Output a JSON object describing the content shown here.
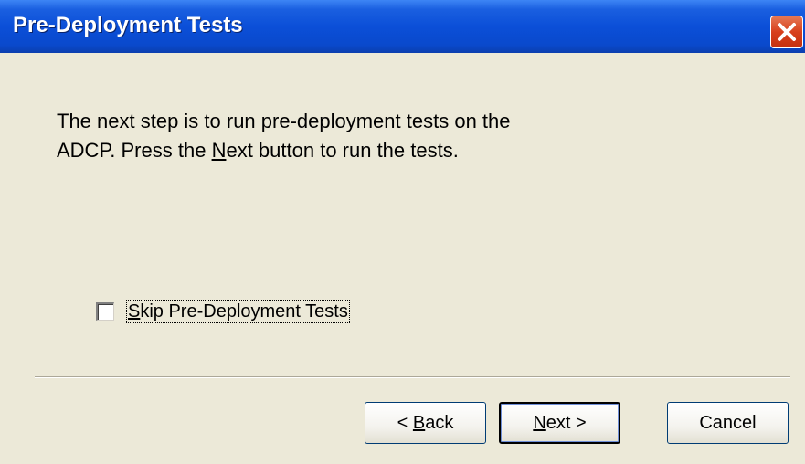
{
  "window": {
    "title": "Pre-Deployment Tests"
  },
  "message": {
    "line_start": "The next step is to run pre-deployment tests on the ADCP.  Press the ",
    "accel_char": "N",
    "line_mid": "ext",
    "line_end": " button to run the tests."
  },
  "checkbox": {
    "accel_char": "S",
    "label_rest": "kip Pre-Deployment Tests",
    "checked": false
  },
  "buttons": {
    "back_prefix": "< ",
    "back_accel": "B",
    "back_rest": "ack",
    "next_accel": "N",
    "next_rest": "ext >",
    "cancel_label": "Cancel"
  },
  "icons": {
    "close": "close-icon"
  },
  "colors": {
    "titlebar": "#0b4fd8",
    "dialog_bg": "#ece9d8",
    "close_button": "#d8401c"
  }
}
